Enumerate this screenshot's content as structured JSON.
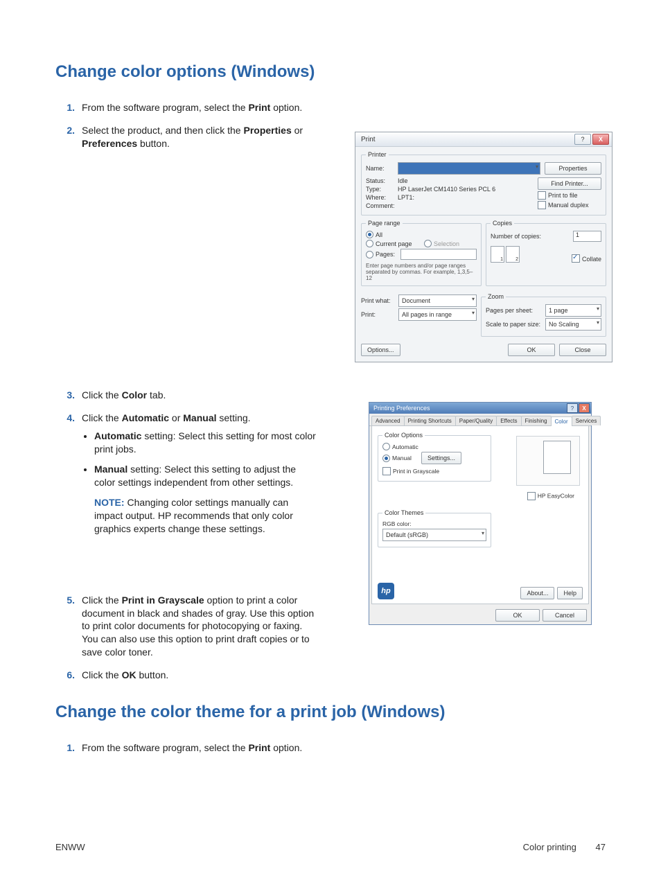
{
  "headings": {
    "h1a": "Change color options (Windows)",
    "h1b": "Change the color theme for a print job (Windows)"
  },
  "steps_a": {
    "s1": {
      "num": "1.",
      "pre": "From the software program, select the ",
      "b": "Print",
      "post": " option."
    },
    "s2": {
      "num": "2.",
      "pre": "Select the product, and then click the ",
      "b1": "Properties",
      "mid": " or ",
      "b2": "Preferences",
      "post": " button."
    },
    "s3": {
      "num": "3.",
      "pre": "Click the ",
      "b": "Color",
      "post": " tab."
    },
    "s4": {
      "num": "4.",
      "pre": "Click the ",
      "b1": "Automatic",
      "mid": " or ",
      "b2": "Manual",
      "post": " setting.",
      "bullets": {
        "auto": {
          "b": "Automatic",
          "txt": " setting: Select this setting for most color print jobs."
        },
        "man": {
          "b": "Manual",
          "txt": " setting: Select this setting to adjust the color settings independent from other settings."
        },
        "note": {
          "lbl": "NOTE:",
          "txt": "   Changing color settings manually can impact output. HP recommends that only color graphics experts change these settings."
        }
      }
    },
    "s5": {
      "num": "5.",
      "pre": "Click the ",
      "b": "Print in Grayscale",
      "post": " option to print a color document in black and shades of gray. Use this option to print color documents for photocopying or faxing. You can also use this option to print draft copies or to save color toner."
    },
    "s6": {
      "num": "6.",
      "pre": "Click the ",
      "b": "OK",
      "post": " button."
    }
  },
  "steps_b": {
    "s1": {
      "num": "1.",
      "pre": "From the software program, select the ",
      "b": "Print",
      "post": " option."
    }
  },
  "footer": {
    "left": "ENWW",
    "right": "Color printing",
    "page": "47"
  },
  "printdlg": {
    "title": "Print",
    "printer_legend": "Printer",
    "name_lbl": "Name:",
    "status_lbl": "Status:",
    "status_val": "Idle",
    "type_lbl": "Type:",
    "type_val": "HP LaserJet CM1410 Series PCL 6",
    "where_lbl": "Where:",
    "where_val": "LPT1:",
    "comment_lbl": "Comment:",
    "properties_btn": "Properties",
    "find_btn": "Find Printer...",
    "print_to_file": "Print to file",
    "manual_duplex": "Manual duplex",
    "pagerange_legend": "Page range",
    "all": "All",
    "current": "Current page",
    "selection": "Selection",
    "pages": "Pages:",
    "pages_hint": "Enter page numbers and/or page ranges separated by commas.  For example, 1,3,5–12",
    "copies_legend": "Copies",
    "num_copies": "Number of copies:",
    "copies_val": "1",
    "collate": "Collate",
    "printwhat_lbl": "Print what:",
    "printwhat_val": "Document",
    "print_lbl": "Print:",
    "print_val": "All pages in range",
    "zoom_legend": "Zoom",
    "pps_lbl": "Pages per sheet:",
    "pps_val": "1 page",
    "scale_lbl": "Scale to paper size:",
    "scale_val": "No Scaling",
    "options_btn": "Options...",
    "ok": "OK",
    "close": "Close"
  },
  "prefs": {
    "title": "Printing Preferences",
    "tabs": [
      "Advanced",
      "Printing Shortcuts",
      "Paper/Quality",
      "Effects",
      "Finishing",
      "Color",
      "Services"
    ],
    "opt_legend": "Color Options",
    "automatic": "Automatic",
    "manual": "Manual",
    "settings_btn": "Settings...",
    "grayscale": "Print in Grayscale",
    "easycolor": "HP EasyColor",
    "themes_legend": "Color Themes",
    "rgb_lbl": "RGB color:",
    "rgb_val": "Default (sRGB)",
    "about": "About...",
    "help": "Help",
    "ok": "OK",
    "cancel": "Cancel",
    "hp": "hp"
  }
}
